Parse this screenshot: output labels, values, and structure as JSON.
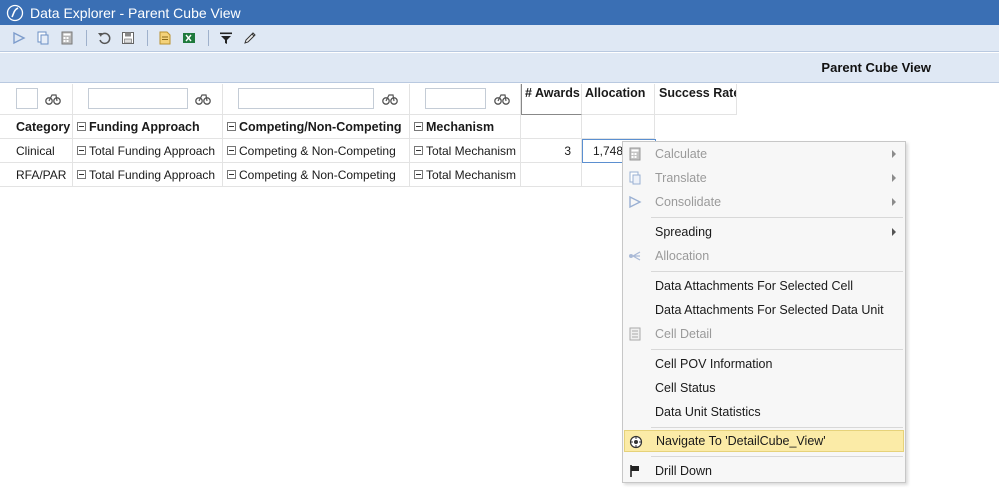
{
  "window": {
    "title": "Data Explorer - Parent Cube View"
  },
  "toolbar": {
    "icons": [
      "run-icon",
      "copy-icon",
      "calculator-icon",
      "undo-icon",
      "save-icon",
      "report-icon",
      "excel-icon",
      "filter-icon",
      "edit-icon"
    ]
  },
  "view": {
    "title": "Parent Cube View"
  },
  "grid": {
    "value_headers": [
      "# Awards",
      "Allocation",
      "Success Rate"
    ],
    "dim_headers": [
      "Category",
      "Funding Approach",
      "Competing/Non-Competing",
      "Mechanism"
    ],
    "rows": [
      {
        "category": "Clinical",
        "funding": "Total Funding Approach",
        "competing": "Competing & Non-Competing",
        "mechanism": "Total Mechanism",
        "awards": "3",
        "allocation": "1,748"
      },
      {
        "category": "RFA/PAR",
        "funding": "Total Funding Approach",
        "competing": "Competing & Non-Competing",
        "mechanism": "Total Mechanism",
        "awards": "",
        "allocation": ""
      }
    ]
  },
  "context_menu": {
    "calculate": "Calculate",
    "translate": "Translate",
    "consolidate": "Consolidate",
    "spreading": "Spreading",
    "allocation": "Allocation",
    "attach_cell": "Data Attachments For Selected Cell",
    "attach_unit": "Data Attachments For Selected Data Unit",
    "cell_detail": "Cell Detail",
    "pov_info": "Cell POV Information",
    "cell_status": "Cell Status",
    "unit_stats": "Data Unit Statistics",
    "navigate": "Navigate To 'DetailCube_View'",
    "drill_down": "Drill Down"
  },
  "colors": {
    "titlebar": "#3a6fb4",
    "toolbar": "#dfe8f4",
    "highlight": "#fbeba7"
  }
}
